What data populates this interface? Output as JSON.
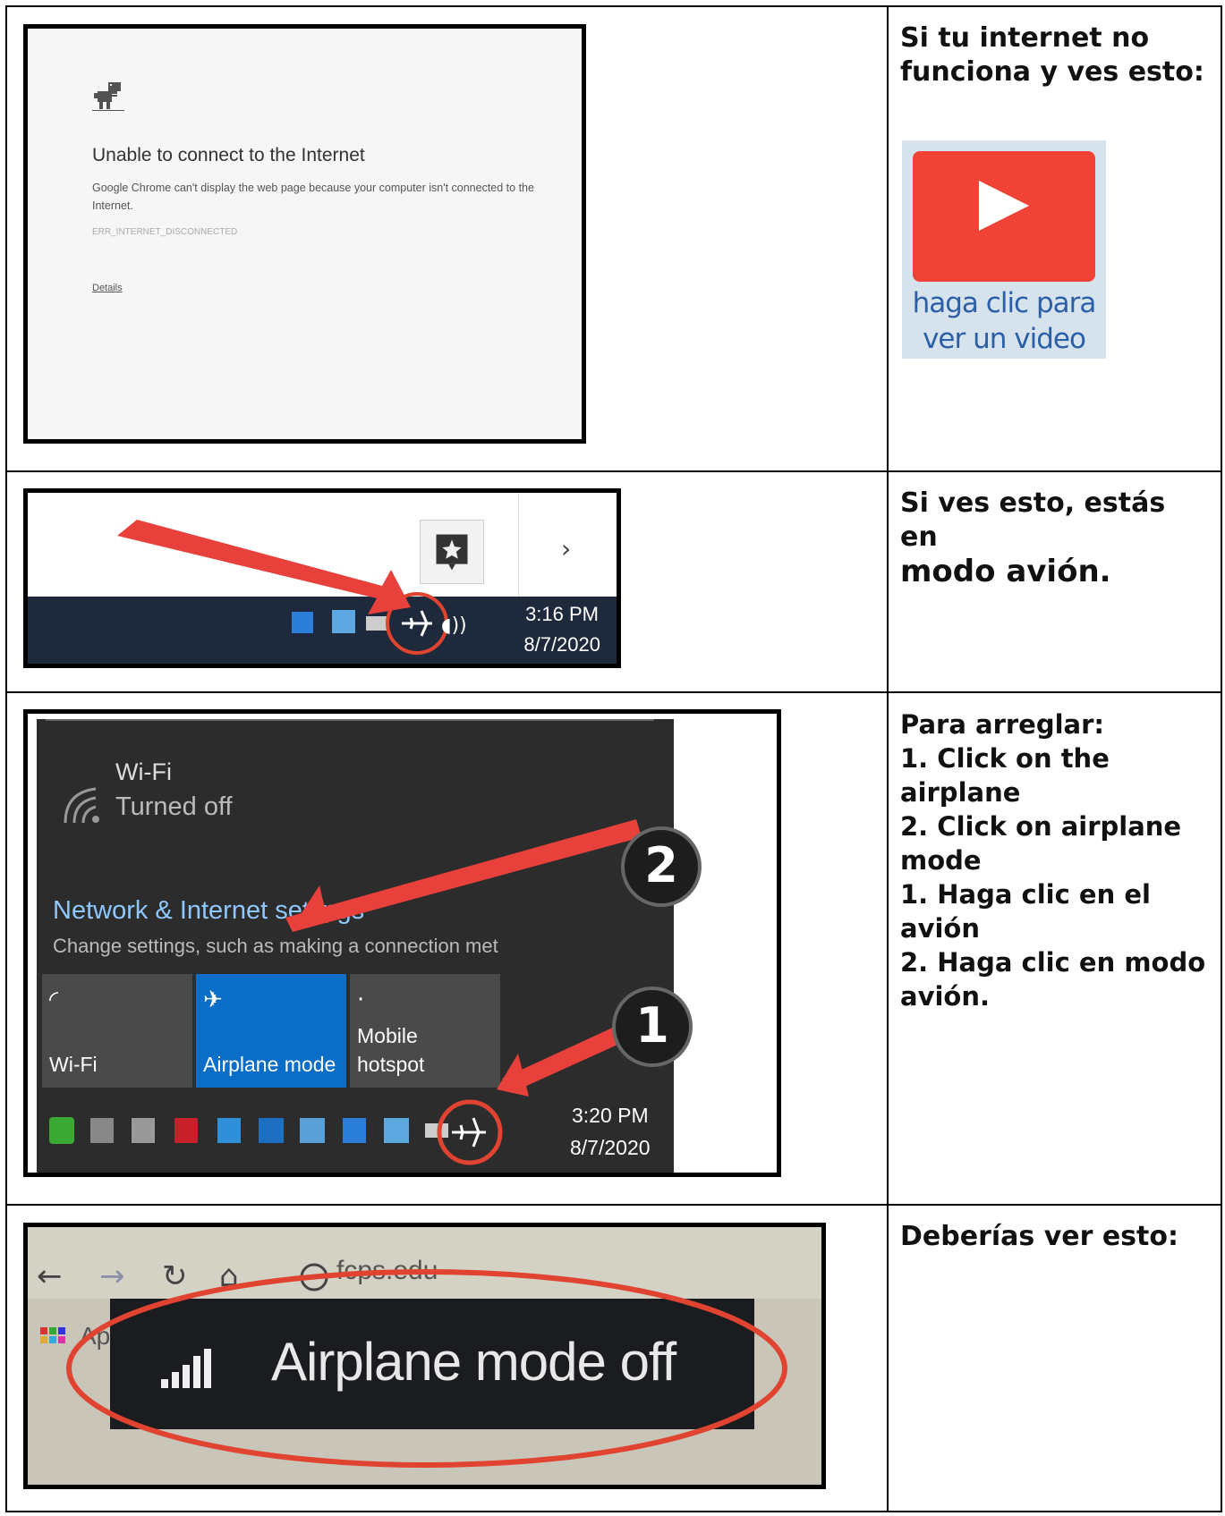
{
  "row1": {
    "chrome": {
      "heading": "Unable to connect to the Internet",
      "description": "Google Chrome can't display the web page because your computer isn't connected to the Internet.",
      "error_code": "ERR_INTERNET_DISCONNECTED",
      "details_link": "Details"
    },
    "instruction_line1": "Si tu internet no",
    "instruction_line2": "funciona y ves esto:",
    "video_button": {
      "line1": "haga clic para",
      "line2": "ver un video",
      "color": "#f04235"
    }
  },
  "row2": {
    "taskbar": {
      "time": "3:16 PM",
      "date": "8/7/2020"
    },
    "instruction_line1": "Si ves esto, estás en",
    "instruction_line2": "modo avión."
  },
  "row3": {
    "flyout": {
      "wifi_title": "Wi-Fi",
      "wifi_status": "Turned off",
      "network_settings": "Network & Internet settings",
      "network_settings_desc": "Change settings, such as making a connection met",
      "tiles": [
        {
          "label": "Wi-Fi",
          "icon": "wifi-icon",
          "color": "#4a4a4a"
        },
        {
          "label": "Airplane mode",
          "icon": "airplane-icon",
          "color": "#0a6dc7"
        },
        {
          "label_line1": "Mobile",
          "label_line2": "hotspot",
          "icon": "hotspot-icon",
          "color": "#4a4a4a"
        }
      ],
      "time": "3:20 PM",
      "date": "8/7/2020",
      "step_badges": [
        "2",
        "1"
      ]
    },
    "instructions": [
      "Para arreglar:",
      "1. Click on the",
      "airplane",
      "2. Click on airplane",
      "mode",
      "1. Haga clic en el",
      "avión",
      "2. Haga clic en modo",
      "avión."
    ]
  },
  "row4": {
    "browser": {
      "url_partial": "fcps.edu",
      "apps_partial": "Ap"
    },
    "toast": "Airplane mode off",
    "instruction": "Deberías ver esto:"
  },
  "colors": {
    "arrow": "#e8403a",
    "highlight_circle": "#e0432f",
    "taskbar": "#1e2a3c",
    "link_blue": "#8ec8ff"
  }
}
